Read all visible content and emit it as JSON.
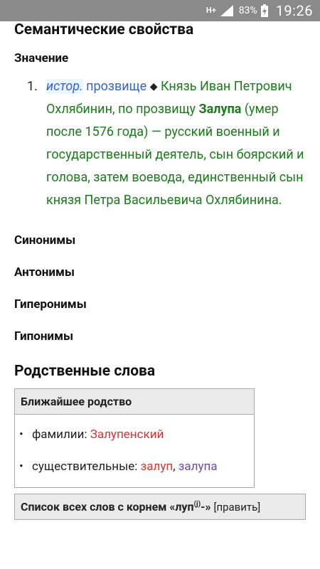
{
  "status": {
    "network": "H+",
    "battery": "83%",
    "time": "19:26"
  },
  "section_title": "Семантические свойства",
  "meaning": {
    "heading": "Значение",
    "items": [
      {
        "number": "1.",
        "label": "истор.",
        "nickname": "прозвище",
        "text_before": "Князь Иван Петрович Охлябинин, по прозвищу",
        "bold_word": "Залупа",
        "text_after": "(умер после 1576 года) — русский военный и государственный деятель, сын боярский и голова, затем воевода, единственный сын князя Петра Васильевича Охлябинина."
      }
    ]
  },
  "subsections": [
    "Синонимы",
    "Антонимы",
    "Гиперонимы",
    "Гипонимы"
  ],
  "related": {
    "title": "Родственные слова",
    "table_header": "Ближайшее родство",
    "families_label": "фамилии:",
    "families_word": "Залупенский",
    "nouns_label": "существительные:",
    "nouns_word1": "залуп",
    "nouns_sep": ",",
    "nouns_word2": "залупа"
  },
  "all_words": {
    "prefix": "Список всех слов с корнем «луп",
    "sup": "(j)",
    "suffix": "-»",
    "edit_open": "[",
    "edit_label": "править",
    "edit_close": "]"
  },
  "colors": {
    "status_bg": "#8a8a8a",
    "green_text": "#1a7c1a",
    "link_blue": "#3366cc",
    "red_link": "#d33333",
    "visited_purple": "#6b4ba1"
  }
}
